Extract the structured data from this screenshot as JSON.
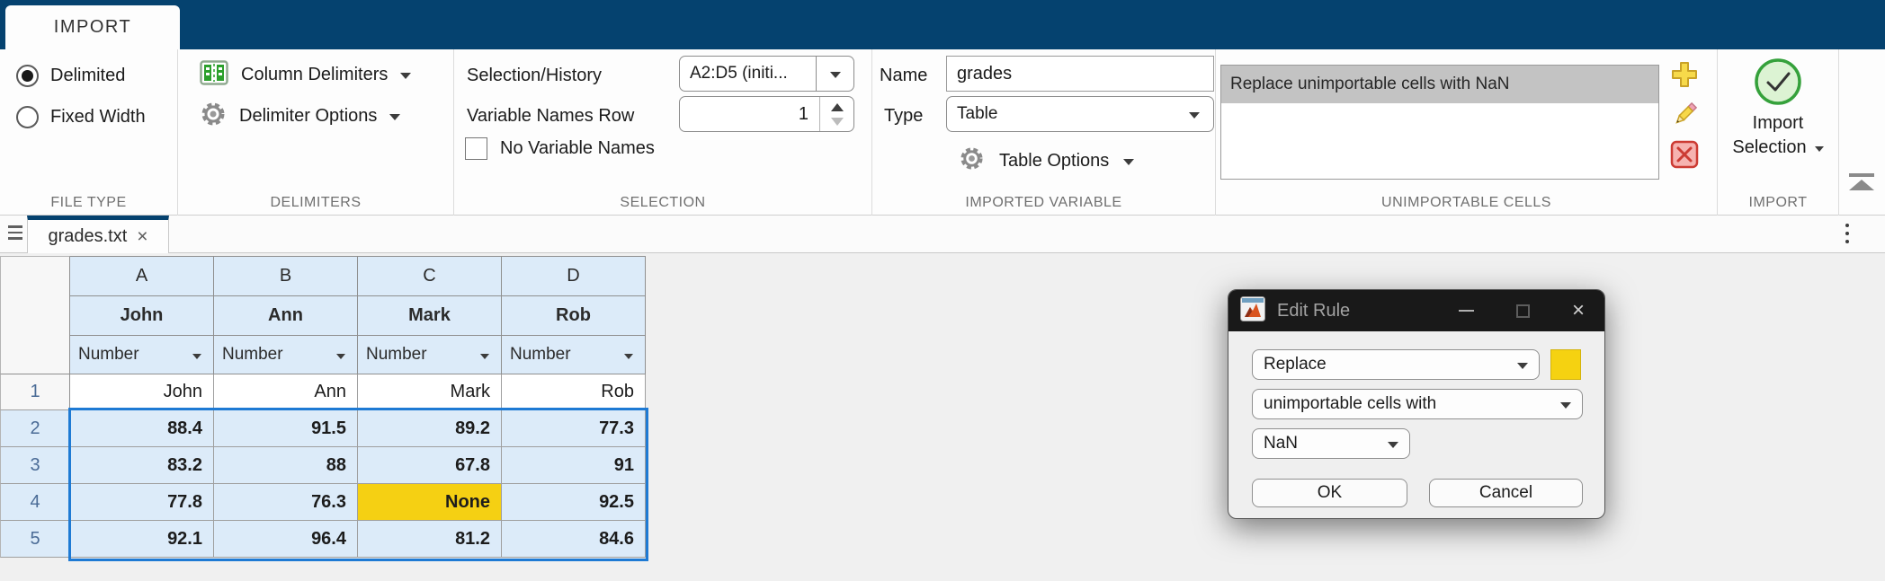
{
  "ribbon": {
    "tab_label": "IMPORT",
    "file_type": {
      "section_label": "FILE TYPE",
      "delimited": {
        "label": "Delimited",
        "selected": true
      },
      "fixed_width": {
        "label": "Fixed Width",
        "selected": false
      }
    },
    "delimiters": {
      "section_label": "DELIMITERS",
      "column_delimiters_label": "Column Delimiters",
      "delimiter_options_label": "Delimiter Options"
    },
    "selection": {
      "section_label": "SELECTION",
      "selection_history_label": "Selection/History",
      "selection_history_value": "A2:D5 (initi...",
      "variable_names_row_label": "Variable Names Row",
      "variable_names_row_value": "1",
      "no_variable_names_label": "No Variable Names",
      "no_variable_names_checked": false
    },
    "imported_variable": {
      "section_label": "IMPORTED VARIABLE",
      "name_label": "Name",
      "name_value": "grades",
      "type_label": "Type",
      "type_value": "Table",
      "table_options_label": "Table Options"
    },
    "unimportable_cells": {
      "section_label": "UNIMPORTABLE CELLS",
      "rules": [
        "Replace unimportable cells with NaN"
      ],
      "selected_rule": "Replace unimportable cells with NaN"
    },
    "import": {
      "section_label": "IMPORT",
      "button_line1": "Import",
      "button_line2": "Selection"
    }
  },
  "document_tabs": {
    "active_tab_label": "grades.txt",
    "close_glyph": "×"
  },
  "grid": {
    "column_letters": [
      "A",
      "B",
      "C",
      "D"
    ],
    "variable_names": [
      "John",
      "Ann",
      "Mark",
      "Rob"
    ],
    "column_types": [
      "Number",
      "Number",
      "Number",
      "Number"
    ],
    "rows": [
      {
        "num": "1",
        "cells": [
          "John",
          "Ann",
          "Mark",
          "Rob"
        ],
        "selected": false
      },
      {
        "num": "2",
        "cells": [
          "88.4",
          "91.5",
          "89.2",
          "77.3"
        ],
        "selected": true
      },
      {
        "num": "3",
        "cells": [
          "83.2",
          "88",
          "67.8",
          "91"
        ],
        "selected": true
      },
      {
        "num": "4",
        "cells": [
          "77.8",
          "76.3",
          "None",
          "92.5"
        ],
        "selected": true
      },
      {
        "num": "5",
        "cells": [
          "92.1",
          "96.4",
          "81.2",
          "84.6"
        ],
        "selected": true
      }
    ],
    "highlighted_cell": {
      "row_num": "4",
      "column": "C",
      "value": "None",
      "color": "#f5d013"
    },
    "selection_range": "A2:D5"
  },
  "dialog": {
    "title": "Edit Rule",
    "rule_action_value": "Replace",
    "rule_target_value": "unimportable cells with",
    "rule_replacement_value": "NaN",
    "ok_label": "OK",
    "cancel_label": "Cancel",
    "swatch_color": "#f5d211",
    "close_glyph": "×"
  },
  "colors": {
    "ribbon_band": "#05426f",
    "header_cell_blue": "#dcebf9",
    "selection_border_blue": "#1e7ad4",
    "highlight_yellow": "#f5d013",
    "rule_selected_gray": "#c3c3c3",
    "dialog_titlebar": "#191919"
  }
}
